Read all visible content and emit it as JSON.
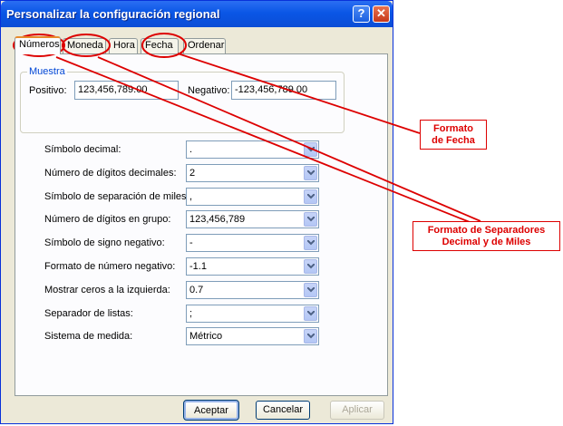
{
  "window": {
    "title": "Personalizar la configuración regional"
  },
  "tabs": [
    {
      "label": "Números",
      "active": true
    },
    {
      "label": "Moneda",
      "active": false
    },
    {
      "label": "Hora",
      "active": false
    },
    {
      "label": "Fecha",
      "active": false
    },
    {
      "label": "Ordenar",
      "active": false
    }
  ],
  "sample": {
    "group_label": "Muestra",
    "positive_label": "Positivo:",
    "positive_value": "123,456,789.00",
    "negative_label": "Negativo:",
    "negative_value": "-123,456,789.00"
  },
  "settings": [
    {
      "label": "Símbolo decimal:",
      "value": "."
    },
    {
      "label": "Número de dígitos decimales:",
      "value": "2"
    },
    {
      "label": "Símbolo de separación de miles:",
      "value": ","
    },
    {
      "label": "Número de dígitos en grupo:",
      "value": "123,456,789"
    },
    {
      "label": "Símbolo de signo negativo:",
      "value": "-"
    },
    {
      "label": "Formato de número negativo:",
      "value": "-1.1"
    },
    {
      "label": "Mostrar ceros a la izquierda:",
      "value": "0.7"
    },
    {
      "label": "Separador de listas:",
      "value": ";"
    },
    {
      "label": "Sistema de medida:",
      "value": "Métrico"
    }
  ],
  "buttons": {
    "ok": "Aceptar",
    "cancel": "Cancelar",
    "apply": "Aplicar"
  },
  "annotations": {
    "date_format": "Formato\nde Fecha",
    "separators_format": "Formato de Separadores\nDecimal y de Miles"
  },
  "colors": {
    "annotation": "#dd0000",
    "title_bar": "#0a56e6"
  }
}
